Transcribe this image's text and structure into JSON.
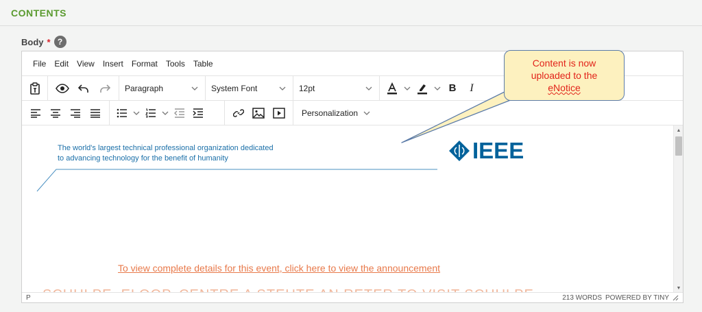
{
  "section": {
    "title": "CONTENTS"
  },
  "field": {
    "label": "Body",
    "required_mark": "*",
    "help": "?"
  },
  "menubar": {
    "items": [
      "File",
      "Edit",
      "View",
      "Insert",
      "Format",
      "Tools",
      "Table"
    ]
  },
  "toolbar": {
    "block_format": "Paragraph",
    "font_family": "System Font",
    "font_size": "12pt",
    "bold": "B",
    "italic": "I",
    "personalization": "Personalization"
  },
  "content": {
    "tagline_line1": "The world's largest technical professional organization dedicated",
    "tagline_line2": "to advancing technology for the benefit of humanity",
    "logo_text": "IEEE",
    "details_link": "To view complete details for this event, click here to view the announcement",
    "cutoff_text": "SCHULPE. ELOOP. CENTRE A STEUTE AN RETER TO VISIT SCHULPE"
  },
  "statusbar": {
    "path": "P",
    "word_count": "213 WORDS",
    "powered_by": "POWERED BY TINY"
  },
  "callout": {
    "line1": "Content is now",
    "line2": "uploaded to the",
    "line3": "eNotice"
  },
  "colors": {
    "section_title": "#5a9a2f",
    "link": "#e8794a",
    "callout_bg": "#fdf1bf",
    "callout_text": "#e2231a",
    "logo": "#00629b"
  }
}
